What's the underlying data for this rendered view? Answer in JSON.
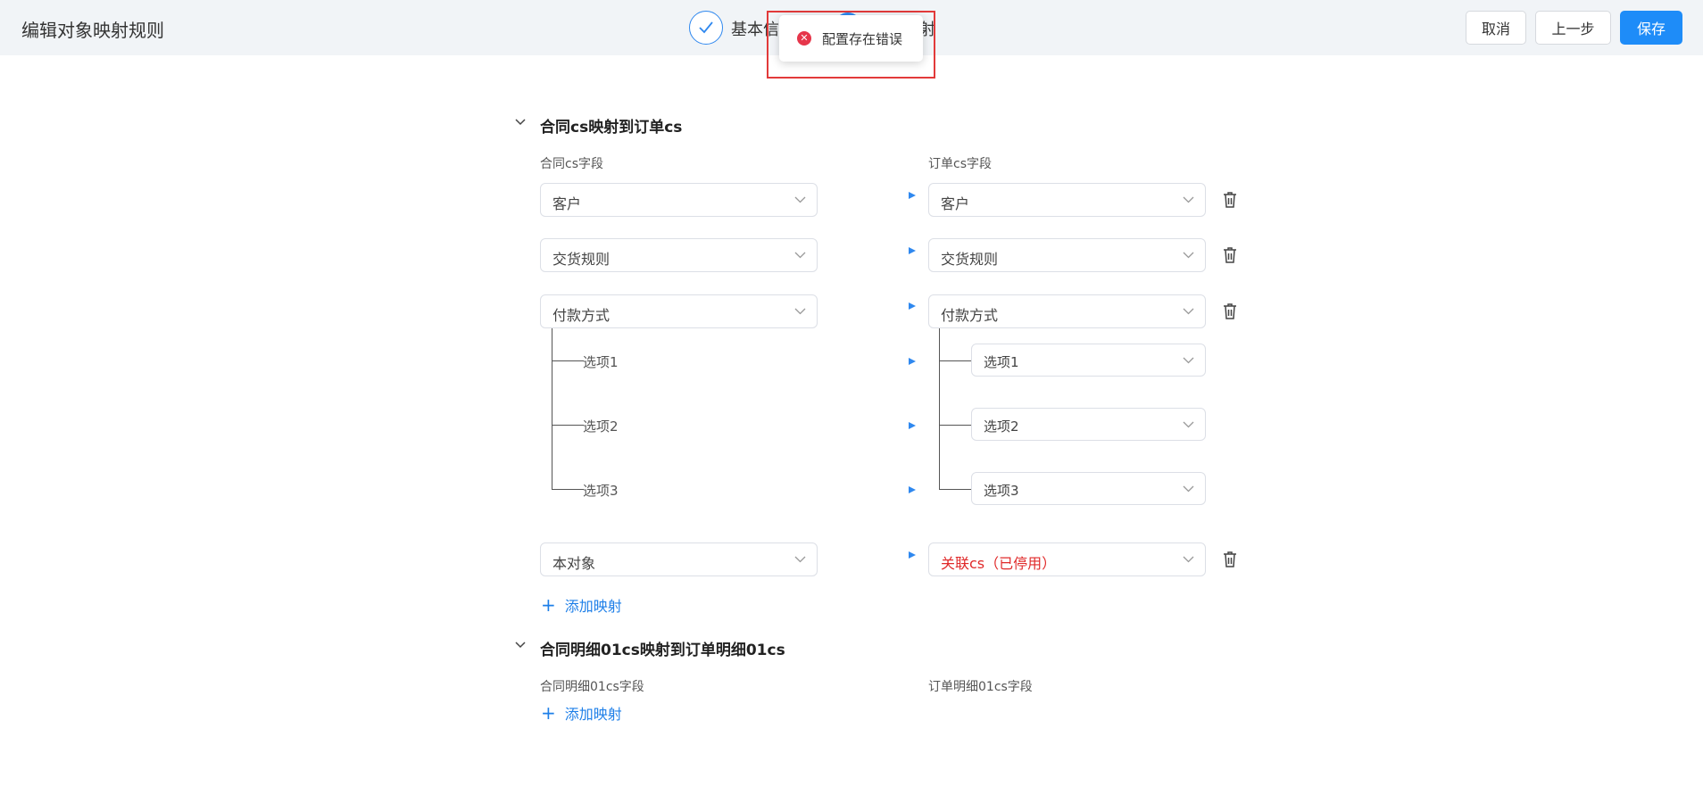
{
  "header": {
    "title": "编辑对象映射规则",
    "steps": [
      {
        "label": "基本信",
        "state": "done"
      },
      {
        "label": "射",
        "state": "active"
      }
    ],
    "buttons": {
      "cancel": "取消",
      "prev": "上一步",
      "save": "保存"
    },
    "accent_color": "#1e8cf8"
  },
  "toast": {
    "type": "error",
    "message": "配置存在错误"
  },
  "sections": [
    {
      "title": "合同cs映射到订单cs",
      "left_col_label": "合同cs字段",
      "right_col_label": "订单cs字段",
      "rows": [
        {
          "left": "客户",
          "right": "客户"
        },
        {
          "left": "交货规则",
          "right": "交货规则"
        },
        {
          "left": "付款方式",
          "right": "付款方式",
          "options": [
            {
              "left": "选项1",
              "right": "选项1"
            },
            {
              "left": "选项2",
              "right": "选项2"
            },
            {
              "left": "选项3",
              "right": "选项3"
            }
          ]
        },
        {
          "left": "本对象",
          "right": "关联cs（已停用）",
          "right_disabled": true
        }
      ],
      "add_label": "添加映射"
    },
    {
      "title": "合同明细01cs映射到订单明细01cs",
      "left_col_label": "合同明细01cs字段",
      "right_col_label": "订单明细01cs字段",
      "rows": [],
      "add_label": "添加映射"
    }
  ]
}
